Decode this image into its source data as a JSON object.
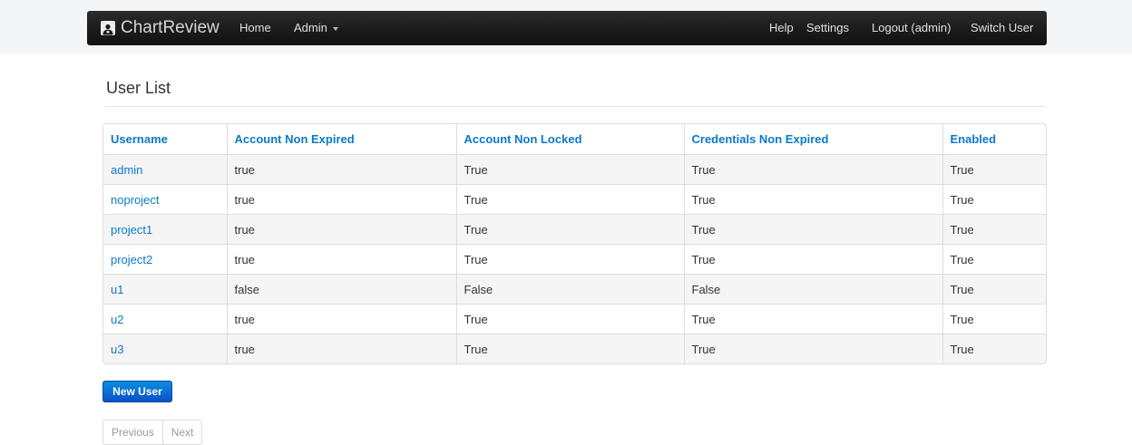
{
  "navbar": {
    "brand": "ChartReview",
    "links": {
      "home": "Home",
      "admin": "Admin",
      "help": "Help",
      "settings": "Settings",
      "logout": "Logout (admin)",
      "switch_user": "Switch User"
    }
  },
  "page": {
    "title": "User List"
  },
  "table": {
    "headers": [
      "Username",
      "Account Non Expired",
      "Account Non Locked",
      "Credentials Non Expired",
      "Enabled"
    ],
    "rows": [
      [
        "admin",
        "true",
        "True",
        "True",
        "True"
      ],
      [
        "noproject",
        "true",
        "True",
        "True",
        "True"
      ],
      [
        "project1",
        "true",
        "True",
        "True",
        "True"
      ],
      [
        "project2",
        "true",
        "True",
        "True",
        "True"
      ],
      [
        "u1",
        "false",
        "False",
        "False",
        "True"
      ],
      [
        "u2",
        "true",
        "True",
        "True",
        "True"
      ],
      [
        "u3",
        "true",
        "True",
        "True",
        "True"
      ]
    ]
  },
  "actions": {
    "new_user": "New User"
  },
  "pager": {
    "previous": "Previous",
    "next": "Next"
  },
  "colors": {
    "link": "#0a7ac8",
    "navbar": "#1b1b1b",
    "button": "#0a66d6"
  }
}
